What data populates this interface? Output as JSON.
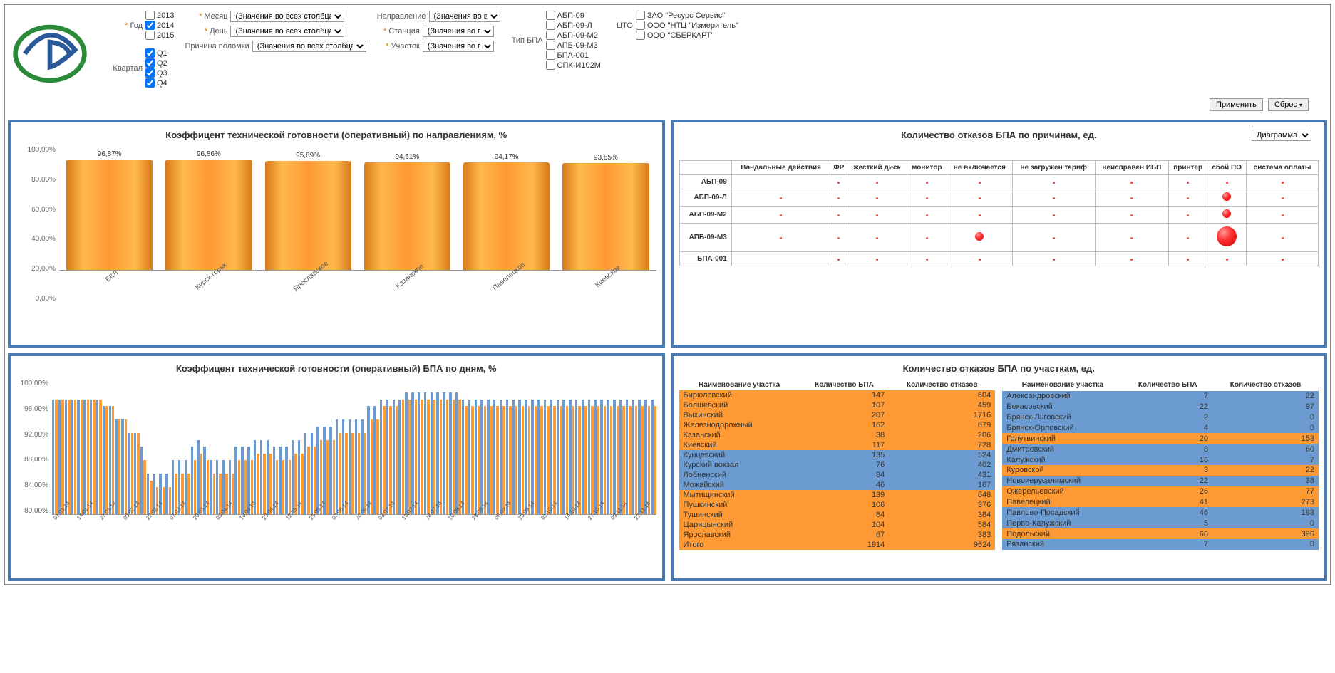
{
  "filters": {
    "year": {
      "label": "Год",
      "options": [
        {
          "label": "2013",
          "checked": false
        },
        {
          "label": "2014",
          "checked": true
        },
        {
          "label": "2015",
          "checked": false
        }
      ]
    },
    "quarter": {
      "label": "Квартал",
      "options": [
        {
          "label": "Q1",
          "checked": true
        },
        {
          "label": "Q2",
          "checked": true
        },
        {
          "label": "Q3",
          "checked": true
        },
        {
          "label": "Q4",
          "checked": true
        }
      ]
    },
    "month": {
      "label": "Месяц",
      "value": "(Значения во всех столбцах)"
    },
    "day": {
      "label": "День",
      "value": "(Значения во всех столбцах)"
    },
    "reason": {
      "label": "Причина поломки",
      "value": "(Значения во всех столбцах)"
    },
    "direction": {
      "label": "Направление",
      "value": "(Значения во всех с"
    },
    "station": {
      "label": "Станция",
      "value": "(Значения во всех с"
    },
    "area": {
      "label": "Участок",
      "value": "(Значения во всех с"
    },
    "bpa_type": {
      "label": "Тип БПА",
      "options": [
        {
          "label": "АБП-09"
        },
        {
          "label": "АБП-09-Л"
        },
        {
          "label": "АБП-09-М2"
        },
        {
          "label": "АПБ-09-М3"
        },
        {
          "label": "БПА-001"
        },
        {
          "label": "СПК-И102М"
        }
      ]
    },
    "cto": {
      "label": "ЦТО",
      "options": [
        {
          "label": "ЗАО \"Ресурс Сервис\""
        },
        {
          "label": "ООО \"НТЦ \"Измеритель\""
        },
        {
          "label": "ООО \"СБЕРКАРТ\""
        }
      ]
    }
  },
  "buttons": {
    "apply": "Применить",
    "reset": "Сброс"
  },
  "panel1": {
    "title": "Коэффицент технической готовности (оперативный) по направлениям, %"
  },
  "panel2": {
    "title": "Количество отказов БПА по причинам, ед.",
    "diagram": "Диаграмма"
  },
  "panel3": {
    "title": "Коэффицент технической готовности (оперативный) БПА по дням, %"
  },
  "panel4": {
    "title": "Количество отказов БПА по участкам, ед."
  },
  "table4_headers": {
    "name": "Наименование участка",
    "count": "Количество БПА",
    "fail": "Количество отказов"
  },
  "chart_data": [
    {
      "type": "bar",
      "title": "Коэффицент технической готовности (оперативный) по направлениям, %",
      "ylabel": "%",
      "ylim": [
        0,
        100
      ],
      "y_ticks": [
        "100,00%",
        "80,00%",
        "60,00%",
        "40,00%",
        "20,00%",
        "0,00%"
      ],
      "categories": [
        "БКЛ",
        "Курск-горьк",
        "Ярославское",
        "Казанское",
        "Павелецкое",
        "Киевское"
      ],
      "values": [
        96.87,
        96.86,
        95.89,
        94.61,
        94.17,
        93.65
      ],
      "value_labels": [
        "96,87%",
        "96,86%",
        "95,89%",
        "94,61%",
        "94,17%",
        "93,65%"
      ]
    },
    {
      "type": "bubble-matrix",
      "title": "Количество отказов БПА по причинам, ед.",
      "rows": [
        "АБП-09",
        "АБП-09-Л",
        "АБП-09-М2",
        "АПБ-09-М3",
        "БПА-001"
      ],
      "columns": [
        "Вандальные действия",
        "ФР",
        "жесткий диск",
        "монитор",
        "не включается",
        "не загружен тариф",
        "неисправен ИБП",
        "принтер",
        "сбой ПО",
        "система оплаты"
      ],
      "sizes": [
        [
          " ",
          "xs",
          "xs",
          "xs",
          "xs",
          "xs",
          "xs",
          "xs",
          "xs",
          "xs"
        ],
        [
          "xs",
          "xs",
          "xs",
          "xs",
          "xs",
          "xs",
          "xs",
          "xs",
          "m",
          "xs"
        ],
        [
          "xs",
          "xs",
          "xs",
          "xs",
          "xs",
          "xs",
          "xs",
          "xs",
          "m",
          "xs"
        ],
        [
          "xs",
          "xs",
          "xs",
          "xs",
          "m",
          "xs",
          "xs",
          "xs",
          "l",
          "xs"
        ],
        [
          " ",
          "xs",
          "xs",
          "xs",
          "xs",
          "xs",
          "xs",
          "xs",
          "xs",
          "xs"
        ]
      ]
    },
    {
      "type": "bar",
      "title": "Коэффицент технической готовности (оперативный) БПА по дням, %",
      "ylabel": "%",
      "ylim": [
        80,
        100
      ],
      "y_ticks": [
        "100,00%",
        "96,00%",
        "92,00%",
        "88,00%",
        "84,00%",
        "80,00%"
      ],
      "x_ticks": [
        "01.01.14",
        "14.01.14",
        "27.01.14",
        "09.02.14",
        "22.02.14",
        "07.03.14",
        "20.03.14",
        "03.04.14",
        "16.04.14",
        "29.04.14",
        "12.05.14",
        "25.05.14",
        "07.06.14",
        "20.06.14",
        "03.07.14",
        "16.07.14",
        "28.07.14",
        "10.08.14",
        "23.08.14",
        "05.09.14",
        "18.09.14",
        "01.10.14",
        "14.10.14",
        "27.10.14",
        "09.11.14",
        "22.11.14"
      ],
      "series": [
        {
          "name": "series1",
          "color": "#6b9bd1",
          "values": [
            97,
            97,
            97,
            97,
            97,
            97,
            97,
            97,
            96,
            96,
            94,
            94,
            92,
            92,
            90,
            86,
            86,
            86,
            86,
            88,
            88,
            88,
            90,
            91,
            90,
            88,
            88,
            88,
            88,
            90,
            90,
            90,
            91,
            91,
            91,
            90,
            90,
            90,
            91,
            91,
            92,
            92,
            93,
            93,
            93,
            94,
            94,
            94,
            94,
            94,
            96,
            96,
            97,
            97,
            97,
            97,
            98,
            98,
            98,
            98,
            98,
            98,
            98,
            98,
            98,
            97,
            97,
            97,
            97,
            97,
            97,
            97,
            97,
            97,
            97,
            97,
            97,
            97,
            97,
            97,
            97,
            97,
            97,
            97,
            97,
            97,
            97,
            97,
            97,
            97,
            97,
            97,
            97,
            97,
            97,
            97
          ]
        },
        {
          "name": "series2",
          "color": "#ff9933",
          "values": [
            97,
            97,
            97,
            97,
            97,
            97,
            97,
            97,
            96,
            96,
            94,
            94,
            92,
            92,
            88,
            85,
            84,
            84,
            84,
            86,
            86,
            86,
            88,
            89,
            88,
            86,
            86,
            86,
            86,
            88,
            88,
            88,
            89,
            89,
            89,
            88,
            88,
            88,
            89,
            89,
            90,
            90,
            91,
            91,
            91,
            92,
            92,
            92,
            92,
            92,
            94,
            94,
            96,
            96,
            96,
            97,
            97,
            97,
            97,
            97,
            97,
            97,
            97,
            97,
            97,
            96,
            96,
            96,
            96,
            96,
            96,
            96,
            96,
            96,
            96,
            96,
            96,
            96,
            96,
            96,
            96,
            96,
            96,
            96,
            96,
            96,
            96,
            96,
            96,
            96,
            96,
            96,
            96,
            96,
            96,
            96
          ]
        }
      ]
    },
    {
      "type": "table",
      "title": "Количество отказов БПА по участкам, ед.",
      "columns": [
        "Наименование участка",
        "Количество БПА",
        "Количество отказов"
      ],
      "left": [
        {
          "name": "Бирюлевский",
          "c": 147,
          "f": 604,
          "color": "o"
        },
        {
          "name": "Болшевский",
          "c": 107,
          "f": 459,
          "color": "o"
        },
        {
          "name": "Выхинский",
          "c": 207,
          "f": 1716,
          "color": "o"
        },
        {
          "name": "Железнодорожный",
          "c": 162,
          "f": 679,
          "color": "o"
        },
        {
          "name": "Казанский",
          "c": 38,
          "f": 206,
          "color": "o"
        },
        {
          "name": "Киевский",
          "c": 117,
          "f": 728,
          "color": "o"
        },
        {
          "name": "Кунцевский",
          "c": 135,
          "f": 524,
          "color": "b"
        },
        {
          "name": "Курский вокзал",
          "c": 76,
          "f": 402,
          "color": "b"
        },
        {
          "name": "Лобненский",
          "c": 84,
          "f": 431,
          "color": "b"
        },
        {
          "name": "Можайский",
          "c": 46,
          "f": 167,
          "color": "b"
        },
        {
          "name": "Мытищинский",
          "c": 139,
          "f": 648,
          "color": "o"
        },
        {
          "name": "Пушкинский",
          "c": 106,
          "f": 376,
          "color": "o"
        },
        {
          "name": "Тушинский",
          "c": 84,
          "f": 384,
          "color": "o"
        },
        {
          "name": "Царицынский",
          "c": 104,
          "f": 584,
          "color": "o"
        },
        {
          "name": "Ярославский",
          "c": 67,
          "f": 383,
          "color": "o"
        },
        {
          "name": "Итого",
          "c": 1914,
          "f": 9624,
          "color": "o"
        }
      ],
      "right": [
        {
          "name": "Александровский",
          "c": 7,
          "f": 22,
          "color": "b"
        },
        {
          "name": "Бекасовский",
          "c": 22,
          "f": 97,
          "color": "b"
        },
        {
          "name": "Брянск-Льговский",
          "c": 2,
          "f": 0,
          "color": "b"
        },
        {
          "name": "Брянск-Орловский",
          "c": 4,
          "f": 0,
          "color": "b"
        },
        {
          "name": "Голутвинский",
          "c": 20,
          "f": 153,
          "color": "o"
        },
        {
          "name": "Дмитровский",
          "c": 8,
          "f": 60,
          "color": "b"
        },
        {
          "name": "Калужский",
          "c": 16,
          "f": 7,
          "color": "b"
        },
        {
          "name": "Куровской",
          "c": 3,
          "f": 22,
          "color": "o"
        },
        {
          "name": "Новоиерусалимский",
          "c": 22,
          "f": 38,
          "color": "b"
        },
        {
          "name": "Ожерельевский",
          "c": 26,
          "f": 77,
          "color": "o"
        },
        {
          "name": "Павелецкий",
          "c": 41,
          "f": 273,
          "color": "o"
        },
        {
          "name": "Павлово-Посадский",
          "c": 46,
          "f": 188,
          "color": "b"
        },
        {
          "name": "Перво-Калужский",
          "c": 5,
          "f": 0,
          "color": "b"
        },
        {
          "name": "Подольский",
          "c": 66,
          "f": 396,
          "color": "o"
        },
        {
          "name": "Рязанский",
          "c": 7,
          "f": 0,
          "color": "b"
        }
      ]
    }
  ]
}
